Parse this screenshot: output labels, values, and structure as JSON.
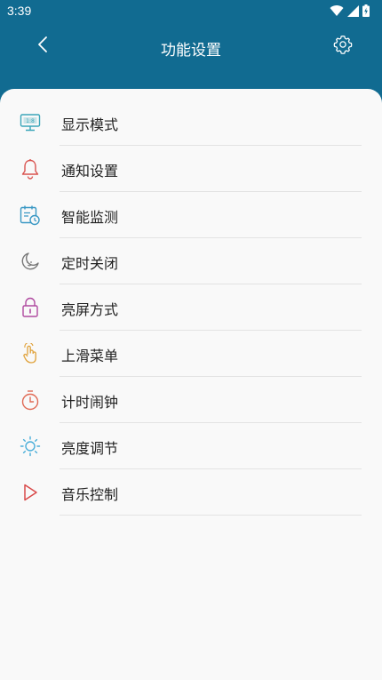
{
  "status_bar": {
    "time": "3:39"
  },
  "header": {
    "title": "功能设置"
  },
  "menu": {
    "items": [
      {
        "label": "显示模式",
        "icon": "display-mode-icon",
        "color": "#3aa6b9"
      },
      {
        "label": "通知设置",
        "icon": "bell-icon",
        "color": "#d9534f"
      },
      {
        "label": "智能监测",
        "icon": "calendar-clock-icon",
        "color": "#3a98c4"
      },
      {
        "label": "定时关闭",
        "icon": "moon-icon",
        "color": "#777777"
      },
      {
        "label": "亮屏方式",
        "icon": "lock-icon",
        "color": "#b04aa0"
      },
      {
        "label": "上滑菜单",
        "icon": "hand-swipe-icon",
        "color": "#e0a23a"
      },
      {
        "label": "计时闹钟",
        "icon": "timer-icon",
        "color": "#e06a55"
      },
      {
        "label": "亮度调节",
        "icon": "sun-icon",
        "color": "#4aaed9"
      },
      {
        "label": "音乐控制",
        "icon": "play-icon",
        "color": "#d94a4a"
      }
    ]
  }
}
